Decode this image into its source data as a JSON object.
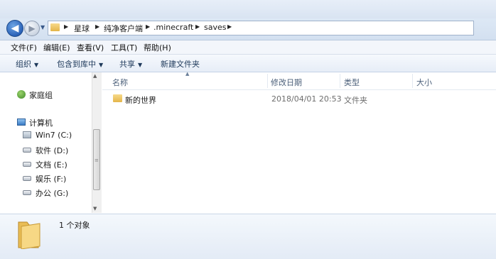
{
  "address": {
    "back_glyph": "◀",
    "forward_glyph": "▶",
    "dropdown_glyph": "▼",
    "separator_glyph": "▶",
    "breadcrumbs": [
      "星球",
      "纯净客户端",
      ".minecraft",
      "saves"
    ]
  },
  "menu": [
    "文件(F)",
    "编辑(E)",
    "查看(V)",
    "工具(T)",
    "帮助(H)"
  ],
  "toolbar": {
    "organize": "组织",
    "include_in_library": "包含到库中",
    "share": "共享",
    "new_folder": "新建文件夹",
    "caret": "▼"
  },
  "nav": {
    "homegroup": "家庭组",
    "computer": "计算机",
    "drives": [
      "Win7 (C:)",
      "软件 (D:)",
      "文档 (E:)",
      "娱乐 (F:)",
      "办公 (G:)"
    ]
  },
  "columns": {
    "name": "名称",
    "date_modified": "修改日期",
    "type": "类型",
    "size": "大小",
    "sort_glyph": "▲"
  },
  "files": [
    {
      "name": "新的世界",
      "date": "2018/04/01 20:53",
      "type": "文件夹",
      "size": ""
    }
  ],
  "details": {
    "item_count": "1 个对象"
  },
  "scrollbar": {
    "up_glyph": "▲",
    "down_glyph": "▼",
    "grip_glyph": "≡"
  },
  "colors": {
    "accent": "#2a62b8",
    "folder": "#e4b54a"
  }
}
